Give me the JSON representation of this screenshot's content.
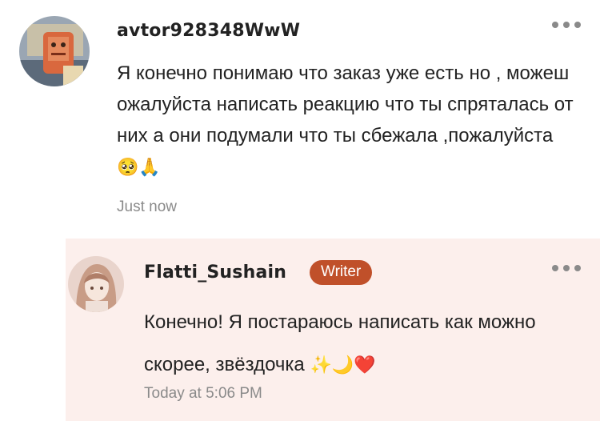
{
  "colors": {
    "reply_background": "#fcefec",
    "writer_badge": "#c0502a",
    "timestamp": "#8a8a8a"
  },
  "comment": {
    "username": "avtor928348WwW",
    "text": "Я конечно понимаю что заказ уже есть но , можеш ожалуйста написать реакцию что ты спряталась от них а они подумали что ты сбежала ,пожалуйста",
    "emojis": "🥺🙏",
    "timestamp": "Just now",
    "more_icon": "more-horizontal-icon"
  },
  "reply": {
    "username": "Flatti_Sushain",
    "badge": "Writer",
    "text": "Конечно! Я постараюсь написать как можно скорее, звёздочка",
    "emojis": "✨🌙❤️",
    "timestamp": "Today at 5:06 PM",
    "more_icon": "more-horizontal-icon"
  }
}
